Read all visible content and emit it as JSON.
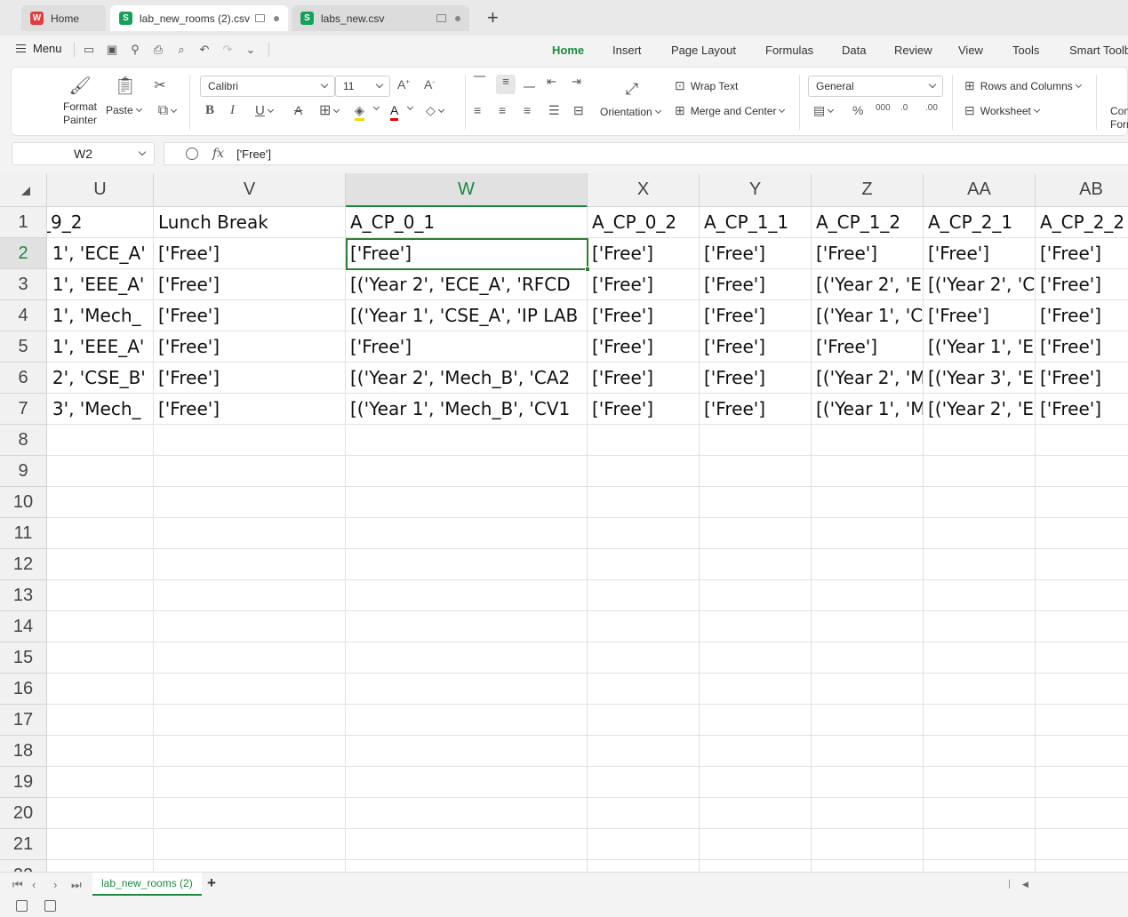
{
  "tabs": {
    "home": "Home",
    "active": "lab_new_rooms (2).csv",
    "other": "labs_new.csv"
  },
  "menu": {
    "label": "Menu",
    "ribbon_tabs": [
      "Home",
      "Insert",
      "Page Layout",
      "Formulas",
      "Data",
      "Review",
      "View",
      "Tools",
      "Smart Toolbox"
    ]
  },
  "ribbon": {
    "format_painter": "Format Painter",
    "format_painter_l1": "Format",
    "format_painter_l2": "Painter",
    "paste": "Paste",
    "font_name": "Calibri",
    "font_size": "11",
    "orientation": "Orientation",
    "wrap_text": "Wrap Text",
    "merge_center": "Merge and Center",
    "number_format": "General",
    "rows_columns": "Rows and Columns",
    "worksheet": "Worksheet",
    "cond_format_l1": "Con",
    "cond_format_l2": "Form"
  },
  "formula_bar": {
    "name_box": "W2",
    "fx": "fx",
    "value": "['Free']"
  },
  "grid": {
    "columns": [
      "U",
      "V",
      "W",
      "X",
      "Y",
      "Z",
      "AA",
      "AB"
    ],
    "selected_column": "W",
    "row_numbers": [
      "1",
      "2",
      "3",
      "4",
      "5",
      "6",
      "7",
      "8",
      "9",
      "10",
      "11",
      "12",
      "13",
      "14",
      "15",
      "16",
      "17",
      "18",
      "19",
      "20",
      "21",
      "22"
    ],
    "rows": [
      [
        "_9_2",
        "Lunch Break",
        "A_CP_0_1",
        "A_CP_0_2",
        "A_CP_1_1",
        "A_CP_1_2",
        "A_CP_2_1",
        "A_CP_2_2"
      ],
      [
        "' 1', 'ECE_A'",
        "['Free']",
        "['Free']",
        "['Free']",
        "['Free']",
        "['Free']",
        "['Free']",
        "['Free']"
      ],
      [
        "' 1', 'EEE_A'",
        "['Free']",
        "[('Year 2', 'ECE_A', 'RFCD",
        "['Free']",
        "['Free']",
        "[('Year 2', 'E",
        "[('Year 2', 'C",
        "['Free']"
      ],
      [
        "' 1', 'Mech_",
        "['Free']",
        "[('Year 1', 'CSE_A', 'IP LAB",
        "['Free']",
        "['Free']",
        "[('Year 1', 'C",
        "['Free']",
        "['Free']"
      ],
      [
        "' 1', 'EEE_A'",
        "['Free']",
        "['Free']",
        "['Free']",
        "['Free']",
        "['Free']",
        "[('Year 1', 'E",
        "['Free']"
      ],
      [
        "' 2', 'CSE_B'",
        "['Free']",
        "[('Year 2', 'Mech_B', 'CA2",
        "['Free']",
        "['Free']",
        "[('Year 2', 'M",
        "[('Year 3', 'E",
        "['Free']"
      ],
      [
        "' 3', 'Mech_",
        "['Free']",
        "[('Year 1', 'Mech_B', 'CV1",
        "['Free']",
        "['Free']",
        "[('Year 1', 'M",
        "[('Year 2', 'E",
        "['Free']"
      ]
    ]
  },
  "sheet_tabs": {
    "active": "lab_new_rooms (2)"
  }
}
